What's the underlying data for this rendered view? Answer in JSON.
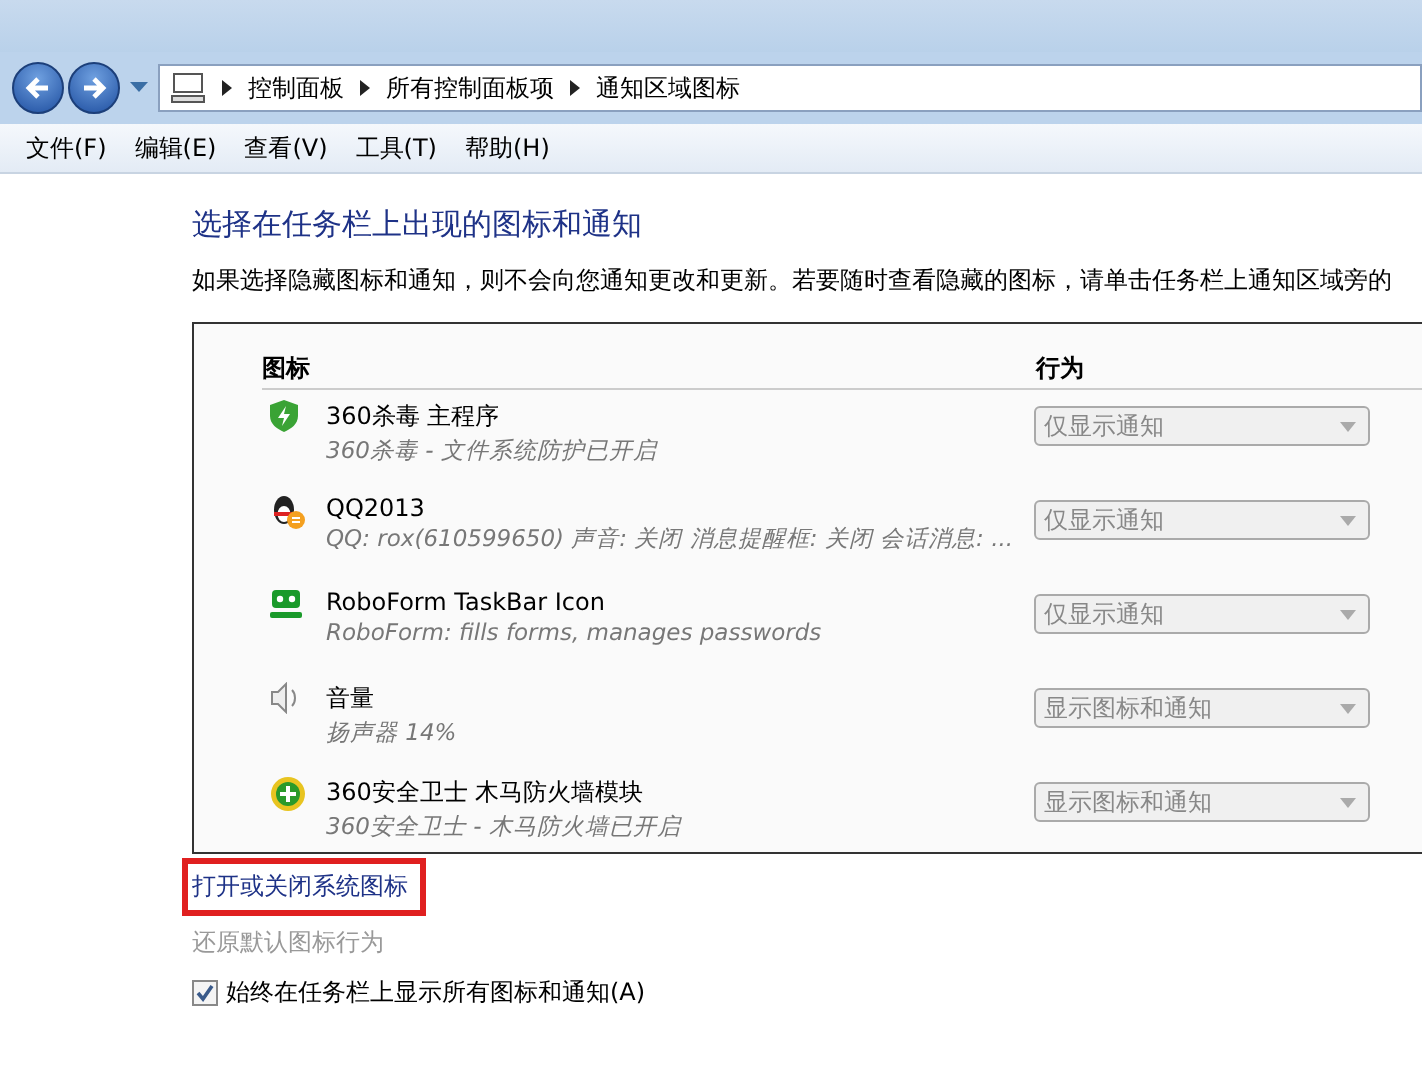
{
  "address_bar": {
    "breadcrumbs": [
      "控制面板",
      "所有控制面板项",
      "通知区域图标"
    ]
  },
  "menu_bar": [
    "文件(F)",
    "编辑(E)",
    "查看(V)",
    "工具(T)",
    "帮助(H)"
  ],
  "heading": "选择在任务栏上出现的图标和通知",
  "description": "如果选择隐藏图标和通知，则不会向您通知更改和更新。若要随时查看隐藏的图标，请单击任务栏上通知区域旁的",
  "table": {
    "columns": [
      "图标",
      "行为"
    ],
    "rows": [
      {
        "kind": "shield",
        "name": "360杀毒 主程序",
        "detail": "360杀毒 - 文件系统防护已开启",
        "behavior": "仅显示通知",
        "disabled": true
      },
      {
        "kind": "penguin",
        "name": "QQ2013",
        "detail": "QQ: rox(610599650)  声音: 关闭  消息提醒框: 关闭  会话消息: ...",
        "behavior": "仅显示通知",
        "disabled": true
      },
      {
        "kind": "robot",
        "name": "RoboForm TaskBar Icon",
        "detail": "RoboForm: fills forms, manages passwords",
        "behavior": "仅显示通知",
        "disabled": true
      },
      {
        "kind": "speaker",
        "name": "音量",
        "detail": "扬声器 14%",
        "behavior": "显示图标和通知",
        "disabled": true
      },
      {
        "kind": "plus",
        "name": "360安全卫士 木马防火墙模块",
        "detail": "360安全卫士 - 木马防火墙已开启",
        "behavior": "显示图标和通知",
        "disabled": true
      }
    ]
  },
  "links": [
    {
      "label": "打开或关闭系统图标",
      "disabled": false,
      "highlighted": true
    },
    {
      "label": "还原默认图标行为",
      "disabled": true,
      "highlighted": false
    }
  ],
  "always_show": {
    "label": "始终在任务栏上显示所有图标和通知(A)",
    "checked": true
  }
}
